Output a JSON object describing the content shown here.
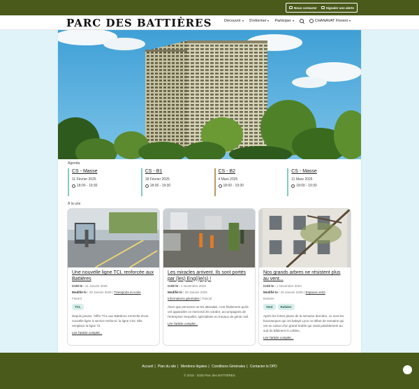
{
  "top_actions": {
    "contact": "Nous contacter",
    "alert": "Signaler une alerte"
  },
  "logo": "PARC DES BATTIÈRES",
  "nav": {
    "discover": "Découvrir",
    "inform": "S'informer",
    "participate": "Participer",
    "user": "CHANAVAT Florent"
  },
  "agenda": {
    "label": "Agenda",
    "items": [
      {
        "title": "CS - Masse",
        "date": "11 Février 2025",
        "time": "18:00 - 19:30"
      },
      {
        "title": "CS - B1",
        "date": "18 Février 2025",
        "time": "18:00 - 19:30"
      },
      {
        "title": "CS - B2",
        "date": "4 Mars 2025",
        "time": "18:00 - 19:30"
      },
      {
        "title": "CS - Masse",
        "date": "11 Mars 2025",
        "time": "18:00 - 19:30"
      }
    ]
  },
  "news": {
    "label": "À la une",
    "cards": [
      {
        "title": "Une nouvelle ligne TCL renforcée aux Battières",
        "created_label": "Créé le :",
        "created": "11 Janvier 2025",
        "modified_label": "Modifié le :",
        "modified": "28 Janvier 2025",
        "category": "Transports et voirie",
        "author": "Florent",
        "tags": [
          "TCL"
        ],
        "excerpt": "Depuis janvier, l'offre TCL aux Battières s'enrichit d'une nouvelle ligne à service renforcé, la ligne C22. Elle remplace la ligne 73.",
        "readmore": "Lire l'article complet..."
      },
      {
        "title": "Les miracles arrivent. Ils sont portés par (les) Eng(i)e(s) !",
        "created_label": "Créé le :",
        "created": "1 Novembre 2023",
        "modified_label": "Modifié le :",
        "modified": "28 Janvier 2025",
        "category": "Informations générales",
        "author": "Pascal",
        "tags": [],
        "excerpt": "Alors que personne ne les attendait, c'est finalement qu'ils ont apparaître ce mercredi 30 octobre, accompagnés de l'entreprise Serpollet, spécialisée en travaux de génie civil.",
        "readmore": "Lire l'article complet..."
      },
      {
        "title": "Nos grands arbres ne résistent plus au vent...",
        "created_label": "Créé le :",
        "created": "1 Novembre 2023",
        "modified_label": "Modifié le :",
        "modified": "28 Janvier 2025",
        "category": "Espaces verts",
        "author": "Damien",
        "tags": [
          "Vent",
          "Rafales"
        ],
        "excerpt": "Après les fortes pluies de la semaine dernière, ce sont les bourrasques qui ont balayé Lyon ce début de semaine qui ont eu raison d'un grand érable qui vivait paisiblement au sud du bâtiment G Lebleu.",
        "readmore": "Lire l'article complet..."
      }
    ]
  },
  "footer": {
    "links": [
      "Accueil",
      "Plan du site",
      "Mentions légales",
      "Conditions Générales",
      "Contacter le DPD"
    ],
    "copyright": "© 2015 - 2025 Parc des BATTIÈRES"
  }
}
